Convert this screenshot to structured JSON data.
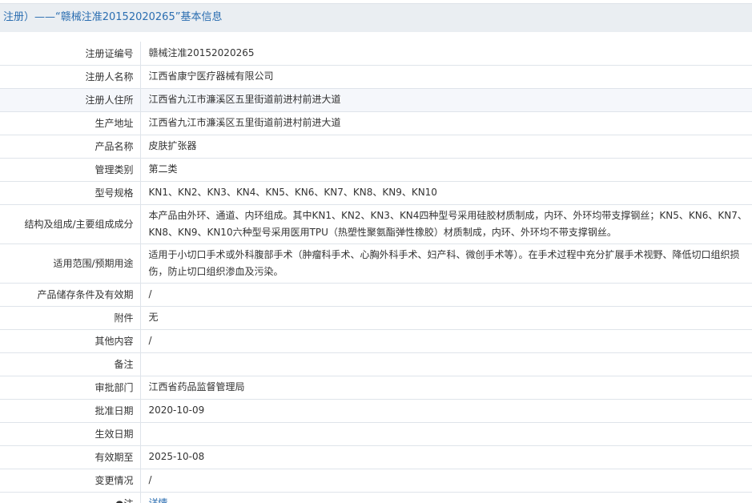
{
  "header": {
    "title": "注册）——“赣械注准20152020265”基本信息"
  },
  "rows": [
    {
      "label": "注册证编号",
      "value": "赣械注准20152020265"
    },
    {
      "label": "注册人名称",
      "value": "江西省康宁医疗器械有限公司"
    },
    {
      "label": "注册人住所",
      "value": "江西省九江市濂溪区五里街道前进村前进大道"
    },
    {
      "label": "生产地址",
      "value": "江西省九江市濂溪区五里街道前进村前进大道"
    },
    {
      "label": "产品名称",
      "value": "皮肤扩张器"
    },
    {
      "label": "管理类别",
      "value": "第二类"
    },
    {
      "label": "型号规格",
      "value": "KN1、KN2、KN3、KN4、KN5、KN6、KN7、KN8、KN9、KN10"
    },
    {
      "label": "结构及组成/主要组成成分",
      "value": "本产品由外环、通道、内环组成。其中KN1、KN2、KN3、KN4四种型号采用硅胶材质制成，内环、外环均带支撑钢丝；KN5、KN6、KN7、KN8、KN9、KN10六种型号采用医用TPU（热塑性聚氨酯弹性橡胶）材质制成，内环、外环均不带支撑钢丝。"
    },
    {
      "label": "适用范围/预期用途",
      "value": "适用于小切口手术或外科腹部手术（肿瘤科手术、心胸外科手术、妇产科、微创手术等）。在手术过程中充分扩展手术视野、降低切口组织损伤，防止切口组织渗血及污染。"
    },
    {
      "label": "产品储存条件及有效期",
      "value": "/"
    },
    {
      "label": "附件",
      "value": "无"
    },
    {
      "label": "其他内容",
      "value": "/"
    },
    {
      "label": "备注",
      "value": ""
    },
    {
      "label": "审批部门",
      "value": "江西省药品监督管理局"
    },
    {
      "label": "批准日期",
      "value": "2020-10-09"
    },
    {
      "label": "生效日期",
      "value": ""
    },
    {
      "label": "有效期至",
      "value": "2025-10-08"
    },
    {
      "label": "变更情况",
      "value": "/"
    },
    {
      "label": "●注",
      "value": "详情"
    }
  ]
}
